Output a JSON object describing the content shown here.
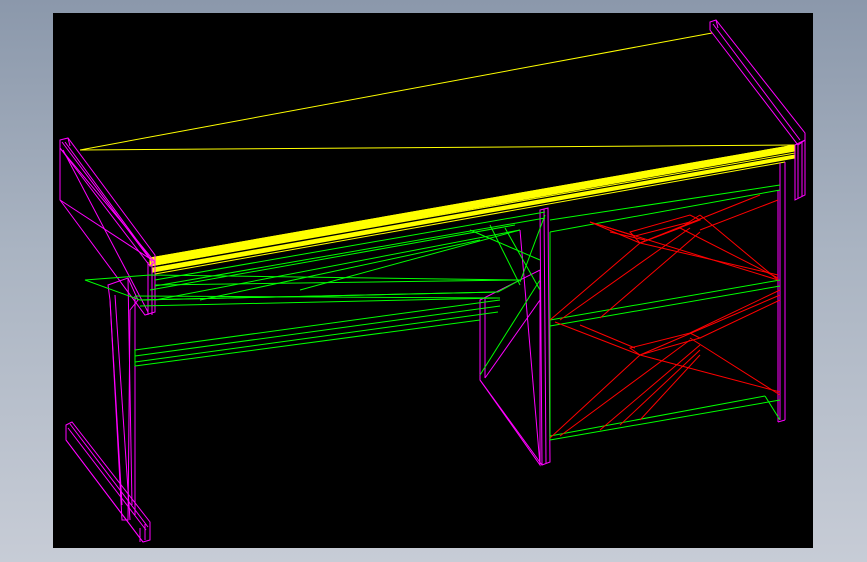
{
  "drawing": {
    "background_color": "#000000",
    "frame_background": "#a9b3c1",
    "subject": "desk-wireframe",
    "line_colors": {
      "tabletop": "#ffff00",
      "end_panels": "#ff00ff",
      "shelves_and_rails": "#00ff00",
      "drawer_fronts": "#ff0000"
    }
  }
}
